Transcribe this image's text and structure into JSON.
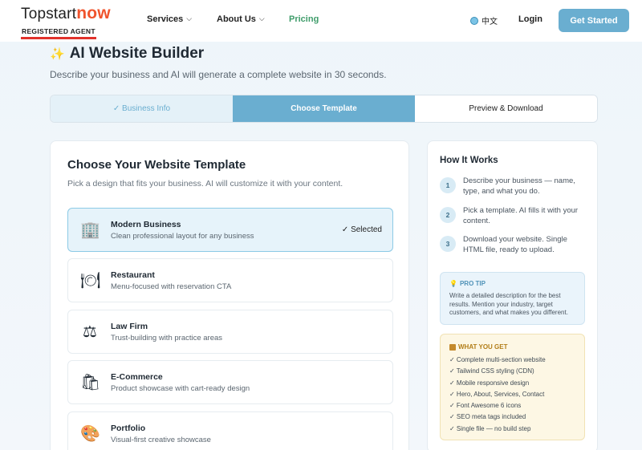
{
  "header": {
    "logo_text": "Topstart",
    "logo_accent": "now",
    "logo_sub": "REGISTERED AGENT",
    "nav": [
      {
        "label": "Services",
        "chev": "⌵"
      },
      {
        "label": "About Us",
        "chev": "⌵"
      },
      {
        "label": "Pricing"
      }
    ],
    "lang": "中文",
    "login": "Login",
    "cta": "Get Started"
  },
  "page": {
    "title": "AI Website Builder",
    "subtitle": "Describe your business and AI will generate a complete website in 30 seconds."
  },
  "steps": [
    {
      "label": "✓ Business Info",
      "state": "done"
    },
    {
      "label": "Choose Template",
      "state": "active"
    },
    {
      "label": "Preview & Download",
      "state": "pending"
    }
  ],
  "main": {
    "title": "Choose Your Website Template",
    "subtitle": "Pick a design that fits your business. AI will customize it with your content.",
    "templates": [
      {
        "icon": "building-icon",
        "glyph": "🏢",
        "name": "Modern Business",
        "desc": "Clean professional layout for any business",
        "selected": true,
        "selected_label": "✓ Selected"
      },
      {
        "icon": "restaurant-icon",
        "glyph": "🍽",
        "name": "Restaurant",
        "desc": "Menu-focused with reservation CTA"
      },
      {
        "icon": "scales-icon",
        "glyph": "⚖",
        "name": "Law Firm",
        "desc": "Trust-building with practice areas"
      },
      {
        "icon": "shopping-bags-icon",
        "glyph": "🛍",
        "name": "E-Commerce",
        "desc": "Product showcase with cart-ready design"
      },
      {
        "icon": "palette-icon",
        "glyph": "🎨",
        "name": "Portfolio",
        "desc": "Visual-first creative showcase"
      }
    ]
  },
  "side": {
    "title": "How It Works",
    "steps": [
      {
        "num": "1",
        "text": "Describe your business — name, type, and what you do."
      },
      {
        "num": "2",
        "text": "Pick a template. AI fills it with your content."
      },
      {
        "num": "3",
        "text": "Download your website. Single HTML file, ready to upload."
      }
    ],
    "tip": {
      "head": "PRO TIP",
      "text": "Write a detailed description for the best results. Mention your industry, target customers, and what makes you different."
    },
    "get": {
      "head": "WHAT YOU GET",
      "items": [
        "✓ Complete multi-section website",
        "✓ Tailwind CSS styling (CDN)",
        "✓ Mobile responsive design",
        "✓ Hero, About, Services, Contact",
        "✓ Font Awesome 6 icons",
        "✓ SEO meta tags included",
        "✓ Single file — no build step"
      ]
    }
  },
  "colors": {
    "accent": "#6aaed0",
    "brand_orange": "#f0542d",
    "brand_red": "#e1322b",
    "pricing_green": "#3f9c6a"
  }
}
